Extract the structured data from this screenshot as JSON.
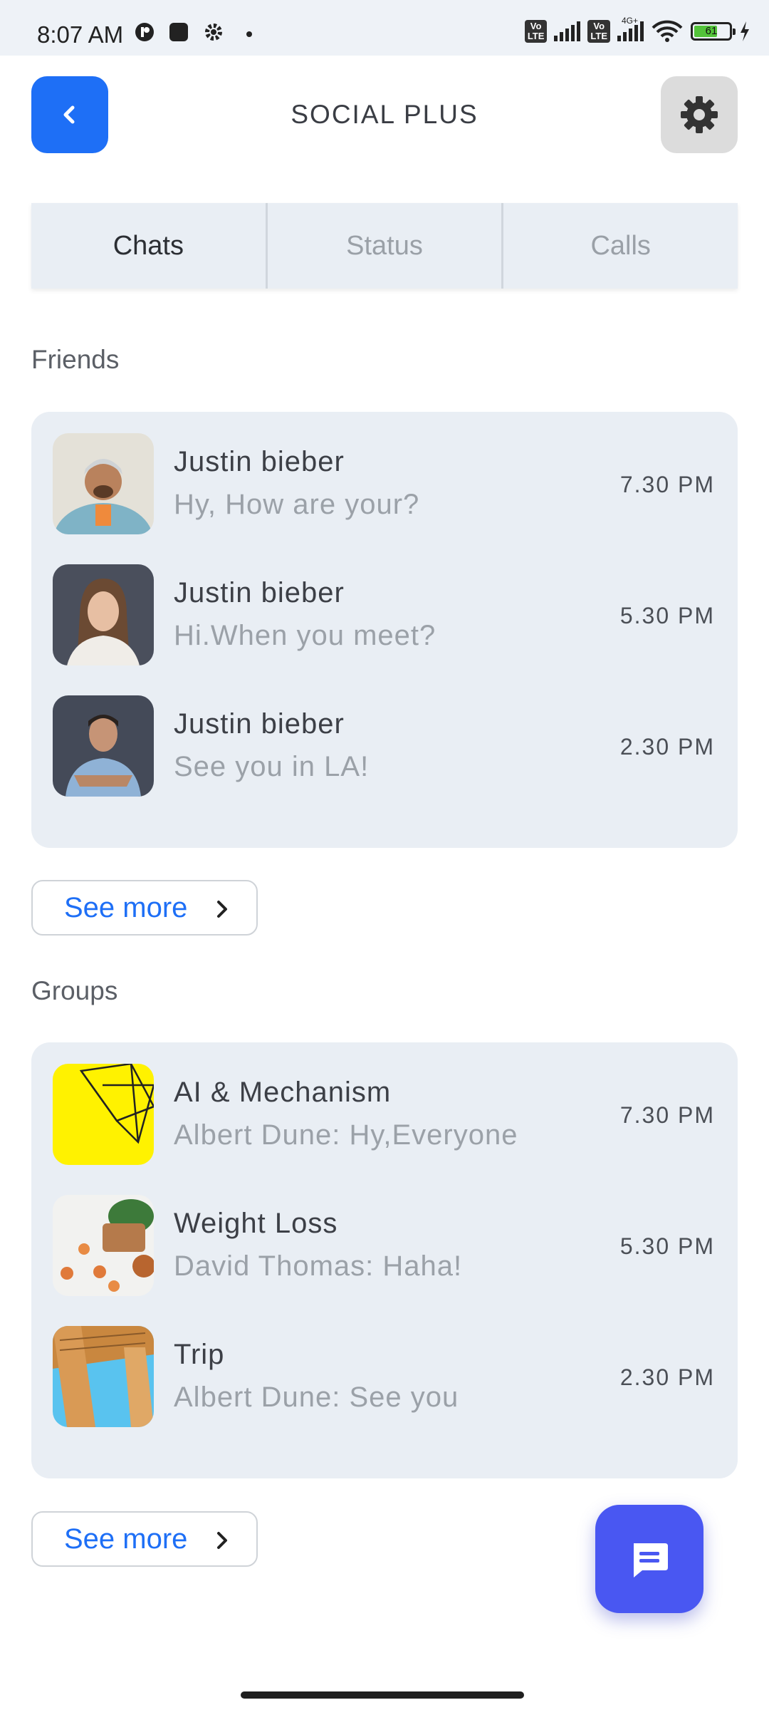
{
  "status_bar": {
    "time": "8:07 AM",
    "battery": "61",
    "network": "4G+",
    "volte": "Vo LTE"
  },
  "header": {
    "title": "SOCIAL PLUS",
    "back_icon": "chevron-left-icon",
    "settings_icon": "gear-icon"
  },
  "tabs": [
    {
      "label": "Chats",
      "active": true
    },
    {
      "label": "Status",
      "active": false
    },
    {
      "label": "Calls",
      "active": false
    }
  ],
  "friends": {
    "label": "Friends",
    "items": [
      {
        "name": "Justin bieber",
        "message": "Hy, How are your?",
        "time": "7.30 PM"
      },
      {
        "name": "Justin bieber",
        "message": "Hi.When you meet?",
        "time": "5.30 PM"
      },
      {
        "name": "Justin bieber",
        "message": "See you in LA!",
        "time": "2.30 PM"
      }
    ],
    "see_more": "See more"
  },
  "groups": {
    "label": "Groups",
    "items": [
      {
        "name": "AI & Mechanism",
        "message": "Albert Dune: Hy,Everyone",
        "time": "7.30 PM"
      },
      {
        "name": "Weight Loss",
        "message": "David Thomas: Haha!",
        "time": "5.30 PM"
      },
      {
        "name": "Trip",
        "message": "Albert Dune: See you",
        "time": "2.30 PM"
      }
    ],
    "see_more": "See more"
  },
  "colors": {
    "primary": "#1e6ff6",
    "fab": "#4957f2",
    "card_bg": "#e9eef4"
  }
}
